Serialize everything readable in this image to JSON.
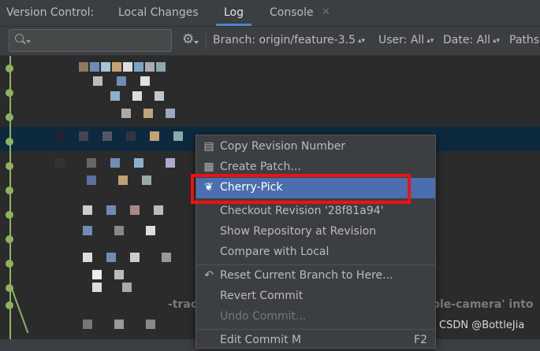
{
  "tabbar": {
    "label": "Version Control:",
    "tabs": [
      {
        "label": "Local Changes"
      },
      {
        "label": "Log"
      },
      {
        "label": "Console"
      }
    ]
  },
  "toolbar": {
    "search_placeholder": "",
    "filters": [
      {
        "label": "Branch: origin/feature-3.5"
      },
      {
        "label": "User: All"
      },
      {
        "label": "Date: All"
      },
      {
        "label": "Paths"
      }
    ]
  },
  "log": {
    "background_fragments": [
      "-track",
      "uble-camera' into"
    ]
  },
  "context_menu": {
    "items": [
      {
        "label": "Copy Revision Number",
        "icon": "clipboard-icon"
      },
      {
        "label": "Create Patch...",
        "icon": "patch-icon"
      },
      {
        "label": "Cherry-Pick",
        "icon": "cherry-icon",
        "active": true
      },
      {
        "label": "Checkout Revision '28f81a94'"
      },
      {
        "label": "Show Repository at Revision"
      },
      {
        "label": "Compare with Local"
      },
      {
        "label": "Reset Current Branch to Here...",
        "icon": "undo-arrow-icon"
      },
      {
        "label": "Revert Commit"
      },
      {
        "label": "Undo Commit...",
        "disabled": true
      },
      {
        "label": "Edit Commit M",
        "shortcut": "F2"
      }
    ]
  },
  "watermark": "CSDN @BottleJia",
  "colors": {
    "accent": "#4a88c7",
    "selection": "#4b6eaf",
    "graph": "#8db360",
    "highlight_box": "#ee1111"
  }
}
